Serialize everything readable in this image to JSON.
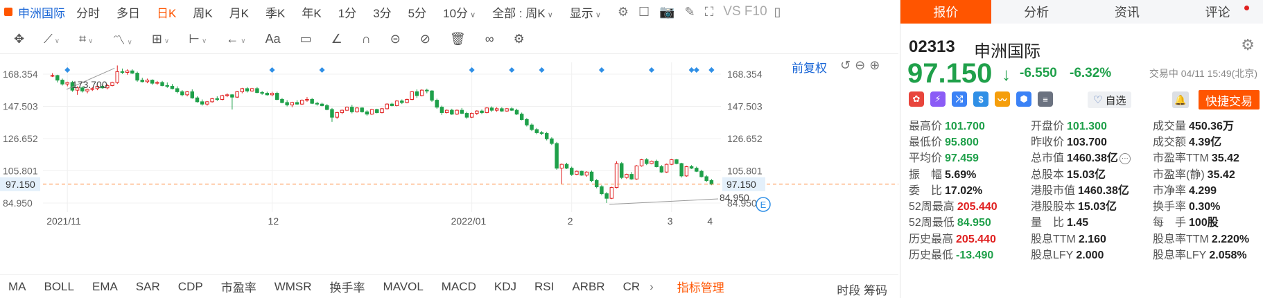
{
  "period_bar": {
    "stock_name": "申洲国际",
    "periods": [
      "分时",
      "多日",
      "日K",
      "周K",
      "月K",
      "季K",
      "年K",
      "1分",
      "3分",
      "5分",
      "10分"
    ],
    "active_period": "日K",
    "range_select": "全部 : 周K",
    "display_label": "显示",
    "vs_label": "VS F10"
  },
  "chart": {
    "adjust_label": "前复权",
    "y_ticks": [
      "168.354",
      "147.503",
      "126.652",
      "105.801",
      "84.950"
    ],
    "y_tick_values": [
      168.354,
      147.503,
      126.652,
      105.801,
      84.95
    ],
    "x_labels": [
      "2021/11",
      "12",
      "2022/01",
      "2",
      "3",
      "4"
    ],
    "current_price_label": "97.150",
    "current_price": 97.15,
    "high_annotation": "173.700",
    "low_annotation": "84.950",
    "event_marker": "E",
    "colors": {
      "up": "#e02020",
      "down": "#1fa04a",
      "price_line": "#ff8a3d",
      "accent": "#1a66d6"
    }
  },
  "chart_data": {
    "type": "candlestick",
    "ylim": [
      80,
      176
    ],
    "series": [
      {
        "name": "",
        "ohlc": [
          [
            167.5,
            169.0,
            166.5,
            167.5
          ],
          [
            167.5,
            168.0,
            163.0,
            164.5
          ],
          [
            164.5,
            165.5,
            161.0,
            162.0
          ],
          [
            162.0,
            163.5,
            160.5,
            163.0
          ],
          [
            163.0,
            164.0,
            157.0,
            158.0
          ],
          [
            158.0,
            160.5,
            155.0,
            159.5
          ],
          [
            159.5,
            160.5,
            156.5,
            157.5
          ],
          [
            157.5,
            159.0,
            156.0,
            158.5
          ],
          [
            158.5,
            160.0,
            157.5,
            159.0
          ],
          [
            159.0,
            161.0,
            158.0,
            160.5
          ],
          [
            160.5,
            161.5,
            159.0,
            159.5
          ],
          [
            159.5,
            162.0,
            158.5,
            161.0
          ],
          [
            161.0,
            163.5,
            160.5,
            163.0
          ],
          [
            163.0,
            174.0,
            162.0,
            170.0
          ],
          [
            170.0,
            172.0,
            168.5,
            169.5
          ],
          [
            169.5,
            171.5,
            168.0,
            170.5
          ],
          [
            170.5,
            171.5,
            168.5,
            169.0
          ],
          [
            169.0,
            170.0,
            163.5,
            164.5
          ],
          [
            164.5,
            166.0,
            163.0,
            163.5
          ],
          [
            163.5,
            165.5,
            162.5,
            164.5
          ],
          [
            164.5,
            165.0,
            161.5,
            162.5
          ],
          [
            162.5,
            164.0,
            161.5,
            163.0
          ],
          [
            163.0,
            164.0,
            160.5,
            161.0
          ],
          [
            161.0,
            163.0,
            159.5,
            160.5
          ],
          [
            160.5,
            162.0,
            158.5,
            159.0
          ],
          [
            159.0,
            160.5,
            156.0,
            157.0
          ],
          [
            157.0,
            158.0,
            154.0,
            155.0
          ],
          [
            155.0,
            157.5,
            154.0,
            157.0
          ],
          [
            157.0,
            158.5,
            152.5,
            153.0
          ],
          [
            153.0,
            154.0,
            150.0,
            150.5
          ],
          [
            150.5,
            152.0,
            148.0,
            149.0
          ],
          [
            149.0,
            151.0,
            148.0,
            150.5
          ],
          [
            150.5,
            153.0,
            150.0,
            152.5
          ],
          [
            152.5,
            154.0,
            151.0,
            152.0
          ],
          [
            152.0,
            155.0,
            151.5,
            154.5
          ],
          [
            154.5,
            156.0,
            153.5,
            155.0
          ],
          [
            155.0,
            155.5,
            145.5,
            153.5
          ],
          [
            153.5,
            157.5,
            153.0,
            157.0
          ],
          [
            157.0,
            159.5,
            156.0,
            159.0
          ],
          [
            159.0,
            160.0,
            156.5,
            157.5
          ],
          [
            157.5,
            159.5,
            157.0,
            159.0
          ],
          [
            159.0,
            160.0,
            156.0,
            156.5
          ],
          [
            156.5,
            157.5,
            155.0,
            156.0
          ],
          [
            156.0,
            157.0,
            154.5,
            155.0
          ],
          [
            155.0,
            157.0,
            154.0,
            156.0
          ],
          [
            156.0,
            157.0,
            151.5,
            152.0
          ],
          [
            152.0,
            153.0,
            149.5,
            150.0
          ],
          [
            150.0,
            151.5,
            147.5,
            148.5
          ],
          [
            148.5,
            150.5,
            147.0,
            150.0
          ],
          [
            150.0,
            151.5,
            148.5,
            149.0
          ],
          [
            149.0,
            152.0,
            148.5,
            151.5
          ],
          [
            151.5,
            153.5,
            150.5,
            152.0
          ],
          [
            152.0,
            153.0,
            149.0,
            149.5
          ],
          [
            149.5,
            150.5,
            148.0,
            149.0
          ],
          [
            149.0,
            150.0,
            147.5,
            148.0
          ],
          [
            148.0,
            149.0,
            145.0,
            145.5
          ],
          [
            145.5,
            146.5,
            137.5,
            140.5
          ],
          [
            140.5,
            144.0,
            139.5,
            143.5
          ],
          [
            143.5,
            145.5,
            142.5,
            145.0
          ],
          [
            145.0,
            147.5,
            144.5,
            147.0
          ],
          [
            147.0,
            148.5,
            143.0,
            144.0
          ],
          [
            144.0,
            147.0,
            143.5,
            146.5
          ],
          [
            146.5,
            147.0,
            143.5,
            144.0
          ],
          [
            144.0,
            145.0,
            141.5,
            142.5
          ],
          [
            142.5,
            146.0,
            142.0,
            145.5
          ],
          [
            145.5,
            146.0,
            143.0,
            143.5
          ],
          [
            143.5,
            146.5,
            143.0,
            146.0
          ],
          [
            146.0,
            149.5,
            145.5,
            149.0
          ],
          [
            149.0,
            150.0,
            147.5,
            148.0
          ],
          [
            148.0,
            151.5,
            147.5,
            151.0
          ],
          [
            151.0,
            152.0,
            149.0,
            150.0
          ],
          [
            150.0,
            152.5,
            149.5,
            152.0
          ],
          [
            152.0,
            157.5,
            151.5,
            157.0
          ],
          [
            157.0,
            158.5,
            153.0,
            154.5
          ],
          [
            154.5,
            158.5,
            154.0,
            158.0
          ],
          [
            158.0,
            159.0,
            156.0,
            157.5
          ],
          [
            157.5,
            158.0,
            150.5,
            151.5
          ],
          [
            151.5,
            152.5,
            146.0,
            147.0
          ],
          [
            147.0,
            148.0,
            142.0,
            143.5
          ],
          [
            143.5,
            145.5,
            143.0,
            145.0
          ],
          [
            145.0,
            146.0,
            142.0,
            142.5
          ],
          [
            142.5,
            145.5,
            142.0,
            145.0
          ],
          [
            145.0,
            146.5,
            142.5,
            143.0
          ],
          [
            143.0,
            144.0,
            139.5,
            140.5
          ],
          [
            140.5,
            143.5,
            140.0,
            143.0
          ],
          [
            143.0,
            145.0,
            142.0,
            144.5
          ],
          [
            144.5,
            145.5,
            142.5,
            143.5
          ],
          [
            143.5,
            147.0,
            143.0,
            146.5
          ],
          [
            146.5,
            147.5,
            144.0,
            145.0
          ],
          [
            145.0,
            147.0,
            144.0,
            146.0
          ],
          [
            146.0,
            147.0,
            144.0,
            144.5
          ],
          [
            144.5,
            146.5,
            144.0,
            146.0
          ],
          [
            146.0,
            147.0,
            144.5,
            145.0
          ],
          [
            145.0,
            146.0,
            142.0,
            142.5
          ],
          [
            142.5,
            143.5,
            138.5,
            139.0
          ],
          [
            139.0,
            140.0,
            134.5,
            135.5
          ],
          [
            135.5,
            136.5,
            131.5,
            132.5
          ],
          [
            132.5,
            133.5,
            129.5,
            130.5
          ],
          [
            130.5,
            131.5,
            129.0,
            130.0
          ],
          [
            130.0,
            131.0,
            125.5,
            126.5
          ],
          [
            126.5,
            127.5,
            122.5,
            123.5
          ],
          [
            123.5,
            124.5,
            106.5,
            107.5
          ],
          [
            107.5,
            110.5,
            97.5,
            110.0
          ],
          [
            110.0,
            111.0,
            107.0,
            107.5
          ],
          [
            107.5,
            108.5,
            102.5,
            103.5
          ],
          [
            103.5,
            106.0,
            103.0,
            105.5
          ],
          [
            105.5,
            106.0,
            102.5,
            103.0
          ],
          [
            103.0,
            105.5,
            102.0,
            105.0
          ],
          [
            105.0,
            106.0,
            98.5,
            99.5
          ],
          [
            99.5,
            100.5,
            94.5,
            95.5
          ],
          [
            95.5,
            96.5,
            90.0,
            91.0
          ],
          [
            91.0,
            92.0,
            85.0,
            88.0
          ],
          [
            88.0,
            95.5,
            87.5,
            95.0
          ],
          [
            95.0,
            112.0,
            94.5,
            110.5
          ],
          [
            110.5,
            111.5,
            100.5,
            101.5
          ],
          [
            101.5,
            104.0,
            100.5,
            103.5
          ],
          [
            103.5,
            105.0,
            100.0,
            100.5
          ],
          [
            100.5,
            109.5,
            100.0,
            109.0
          ],
          [
            109.0,
            113.5,
            108.5,
            113.0
          ],
          [
            113.0,
            114.0,
            109.5,
            110.5
          ],
          [
            110.5,
            112.5,
            110.0,
            112.0
          ],
          [
            112.0,
            113.0,
            108.0,
            108.5
          ],
          [
            108.5,
            109.5,
            104.5,
            105.0
          ],
          [
            105.0,
            110.5,
            104.5,
            110.0
          ],
          [
            110.0,
            113.5,
            109.5,
            113.0
          ],
          [
            113.0,
            113.5,
            110.0,
            110.5
          ],
          [
            110.5,
            111.0,
            101.5,
            102.5
          ],
          [
            102.5,
            109.0,
            102.0,
            108.5
          ],
          [
            108.5,
            109.5,
            107.0,
            107.5
          ],
          [
            107.5,
            108.5,
            105.0,
            105.5
          ],
          [
            105.5,
            106.5,
            101.5,
            102.0
          ],
          [
            102.0,
            103.0,
            98.5,
            99.5
          ],
          [
            99.5,
            100.5,
            96.5,
            97.15
          ]
        ]
      }
    ],
    "x_ticks": [
      "2021/11",
      "12",
      "2022/01",
      "2",
      "3",
      "4"
    ]
  },
  "drawing_tools": [
    "✥",
    "⟋",
    "⌗",
    "〽",
    "⊞",
    "⊢",
    "←",
    "Aa",
    "▭",
    "∠",
    "∩",
    "⊝",
    "⊘",
    "🗑",
    "∞",
    "⚙"
  ],
  "indicators": {
    "items": [
      "MA",
      "BOLL",
      "EMA",
      "SAR",
      "CDP",
      "市盈率",
      "WMSR",
      "换手率",
      "MAVOL",
      "MACD",
      "KDJ",
      "RSI",
      "ARBR",
      "CR"
    ],
    "management": "指标管理",
    "right_label": "时段 筹码"
  },
  "quote": {
    "tabs": [
      "报价",
      "分析",
      "资讯",
      "评论"
    ],
    "code": "02313",
    "name": "申洲国际",
    "price": "97.150",
    "change": "-6.550",
    "change_pct": "-6.32%",
    "status": "交易中 04/11 15:49(北京)",
    "watch_label": "自选",
    "trade_label": "快捷交易",
    "stats": [
      [
        {
          "label": "最高价",
          "value": "101.700",
          "color": "green"
        },
        {
          "label": "开盘价",
          "value": "101.300",
          "color": "green"
        },
        {
          "label": "成交量",
          "value": "450.36万",
          "color": "dark"
        }
      ],
      [
        {
          "label": "最低价",
          "value": "95.800",
          "color": "green"
        },
        {
          "label": "昨收价",
          "value": "103.700",
          "color": "dark"
        },
        {
          "label": "成交额",
          "value": "4.39亿",
          "color": "dark"
        }
      ],
      [
        {
          "label": "平均价",
          "value": "97.459",
          "color": "green"
        },
        {
          "label": "总市值",
          "value": "1460.38亿",
          "color": "dark",
          "more": true
        },
        {
          "label": "市盈率TTM",
          "value": "35.42",
          "color": "dark"
        }
      ],
      [
        {
          "label": "振　幅",
          "value": "5.69%",
          "color": "dark"
        },
        {
          "label": "总股本",
          "value": "15.03亿",
          "color": "dark"
        },
        {
          "label": "市盈率(静)",
          "value": "35.42",
          "color": "dark"
        }
      ],
      [
        {
          "label": "委　比",
          "value": "17.02%",
          "color": "dark"
        },
        {
          "label": "港股市值",
          "value": "1460.38亿",
          "color": "dark"
        },
        {
          "label": "市净率",
          "value": "4.299",
          "color": "dark"
        }
      ],
      [
        {
          "label": "52周最高",
          "value": "205.440",
          "color": "red"
        },
        {
          "label": "港股股本",
          "value": "15.03亿",
          "color": "dark"
        },
        {
          "label": "换手率",
          "value": "0.30%",
          "color": "dark"
        }
      ],
      [
        {
          "label": "52周最低",
          "value": "84.950",
          "color": "green"
        },
        {
          "label": "量　比",
          "value": "1.45",
          "color": "dark"
        },
        {
          "label": "每　手",
          "value": "100股",
          "color": "dark"
        }
      ],
      [
        {
          "label": "历史最高",
          "value": "205.440",
          "color": "red"
        },
        {
          "label": "股息TTM",
          "value": "2.160",
          "color": "dark"
        },
        {
          "label": "股息率TTM",
          "value": "2.220%",
          "color": "dark"
        }
      ],
      [
        {
          "label": "历史最低",
          "value": "-13.490",
          "color": "green"
        },
        {
          "label": "股息LFY",
          "value": "2.000",
          "color": "dark"
        },
        {
          "label": "股息率LFY",
          "value": "2.058%",
          "color": "dark"
        }
      ]
    ]
  }
}
